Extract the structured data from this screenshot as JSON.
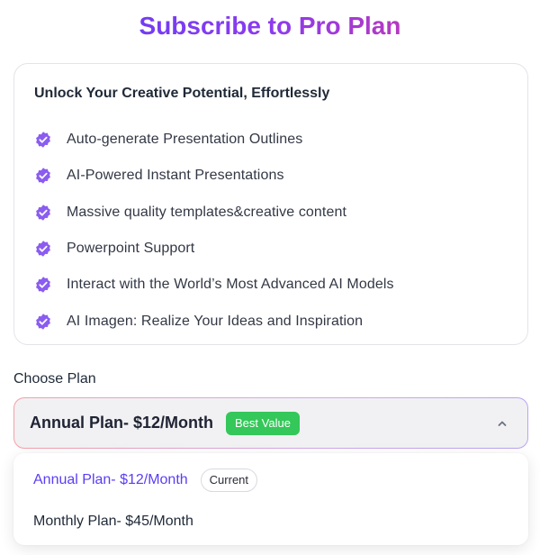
{
  "title": "Subscribe to Pro Plan",
  "features": {
    "heading": "Unlock Your Creative Potential, Effortlessly",
    "items": [
      {
        "label": "Auto-generate Presentation Outlines",
        "icon": "verified-badge-icon"
      },
      {
        "label": "AI-Powered Instant Presentations",
        "icon": "verified-badge-icon"
      },
      {
        "label": "Massive quality templates&creative content",
        "icon": "verified-badge-icon"
      },
      {
        "label": "Powerpoint Support",
        "icon": "verified-badge-icon"
      },
      {
        "label": "Interact with the World’s Most Advanced AI Models",
        "icon": "verified-badge-icon"
      },
      {
        "label": "AI Imagen: Realize Your Ideas and Inspiration",
        "icon": "verified-badge-icon"
      }
    ]
  },
  "choose_plan": {
    "label": "Choose Plan",
    "selected": "Annual Plan- $12/Month",
    "selected_badge": "Best Value",
    "expanded": true,
    "options": [
      {
        "label": "Annual Plan- $12/Month",
        "badge": "Current",
        "active": true
      },
      {
        "label": "Monthly Plan- $45/Month",
        "badge": "",
        "active": false
      }
    ]
  },
  "colors": {
    "accent": "#5b3df5",
    "badge_purple": "#8a5cf0",
    "best_value_green": "#34c759",
    "title_gradient": [
      "#5b3df5",
      "#e2378f"
    ]
  }
}
